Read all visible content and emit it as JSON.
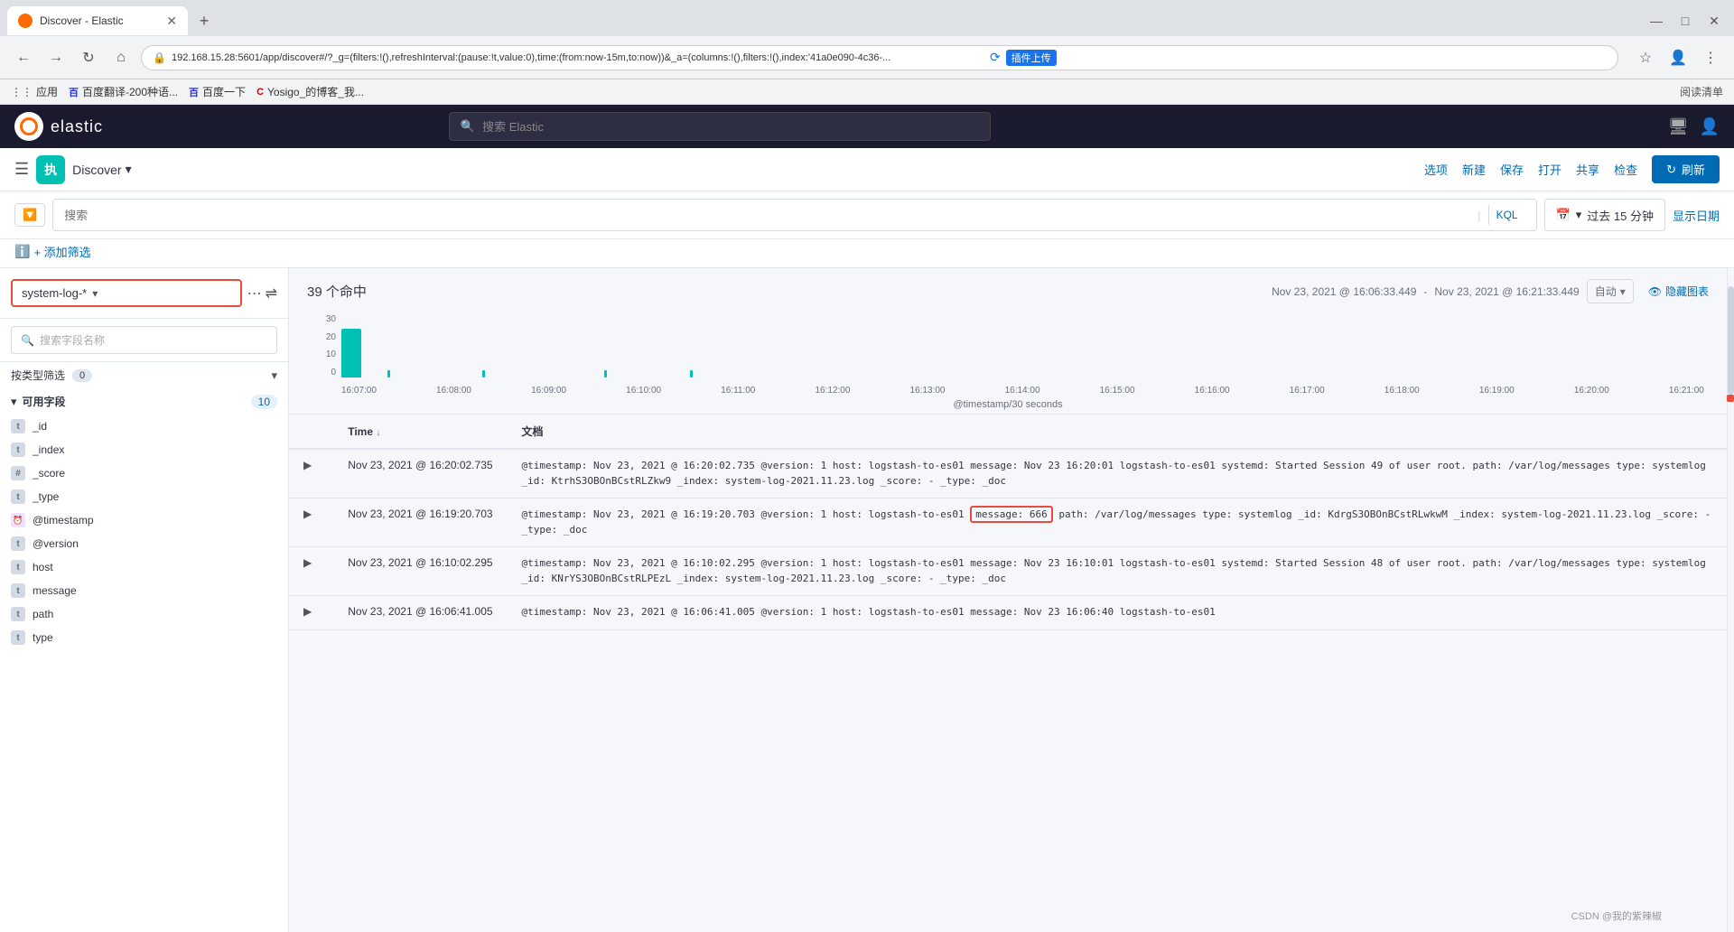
{
  "browser": {
    "tab_title": "Discover - Elastic",
    "address": "192.168.15.28:5601/app/discover#/?_g=(filters:!(),refreshInterval:(pause:!t,value:0),time:(from:now-15m,to:now))&_a=(columns:!(),filters:!(),index:'41a0e090-4c36-...",
    "bookmarks": [
      {
        "label": "应用",
        "icon": "grid"
      },
      {
        "label": "百度翻译-200种语...",
        "icon": "baidu"
      },
      {
        "label": "百度一下",
        "icon": "baidu2"
      },
      {
        "label": "Yosigo_的博客_我...",
        "icon": "csdn"
      }
    ]
  },
  "topnav": {
    "logo_text": "elastic",
    "search_placeholder": "搜索 Elastic",
    "right_icon1": "monitor",
    "right_icon2": "user"
  },
  "secondary_nav": {
    "app_icon": "执",
    "discover_label": "Discover",
    "actions": {
      "options": "选项",
      "new": "新建",
      "save": "保存",
      "open": "打开",
      "share": "共享",
      "inspect": "检查",
      "refresh": "刷新"
    }
  },
  "search_row": {
    "placeholder": "搜索",
    "kql_label": "KQL",
    "calendar_icon": "calendar",
    "time_range": "过去 15 分钟",
    "show_date_label": "显示日期"
  },
  "filter_row": {
    "add_filter_label": "+ 添加筛选"
  },
  "sidebar": {
    "index_pattern": "system-log-*",
    "search_placeholder": "搜索字段名称",
    "filter_type_label": "按类型筛选",
    "filter_count": "0",
    "available_fields_label": "可用字段",
    "available_fields_count": "10",
    "fields": [
      {
        "type": "t",
        "name": "_id"
      },
      {
        "type": "t",
        "name": "_index"
      },
      {
        "type": "hash",
        "name": "_score"
      },
      {
        "type": "t",
        "name": "_type"
      },
      {
        "type": "date",
        "name": "@timestamp"
      },
      {
        "type": "t",
        "name": "@version"
      },
      {
        "type": "t",
        "name": "host"
      },
      {
        "type": "t",
        "name": "message"
      },
      {
        "type": "t",
        "name": "path"
      },
      {
        "type": "t",
        "name": "type"
      }
    ]
  },
  "chart": {
    "results_count": "39 个命中",
    "date_start": "Nov 23, 2021 @ 16:06:33.449",
    "date_end": "Nov 23, 2021 @ 16:21:33.449",
    "auto_label": "自动",
    "hide_chart_label": "隐藏图表",
    "y_axis": [
      "30",
      "20",
      "10",
      "0"
    ],
    "x_axis": [
      "16:07:00",
      "16:08:00",
      "16:09:00",
      "16:10:00",
      "16:11:00",
      "16:12:00",
      "16:13:00",
      "16:14:00",
      "16:15:00",
      "16:16:00",
      "16:17:00",
      "16:18:00",
      "16:19:00",
      "16:20:00",
      "16:21:00"
    ],
    "timestamp_label": "@timestamp/30 seconds"
  },
  "table": {
    "col_time": "Time",
    "col_document": "文档",
    "rows": [
      {
        "time": "Nov 23, 2021 @ 16:20:02.735",
        "content": "@timestamp: Nov 23, 2021 @ 16:20:02.735  @version: 1  host: logstash-to-es01  message: Nov 23 16:20:01 logstash-to-es01 systemd: Started Session 49 of user root.  path: /var/log/messages  type: systemlog  _id: KtrhS3OBOnBCstRLZkw9  _index: system-log-2021.11.23.log  _score: -  _type: _doc"
      },
      {
        "time": "Nov 23, 2021 @ 16:19:20.703",
        "content": "@timestamp: Nov 23, 2021 @ 16:19:20.703  @version: 1  host: logstash-to-es01  [message: 666]  path: /var/log/messages  type: systemlog  _id: KdrgS3OBOnBCstRLwkwM  _index: system-log-2021.11.23.log  _score: -  _type: _doc",
        "highlight": "message: 666"
      },
      {
        "time": "Nov 23, 2021 @ 16:10:02.295",
        "content": "@timestamp: Nov 23, 2021 @ 16:10:02.295  @version: 1  host: logstash-to-es01  message: Nov 23 16:10:01 logstash-to-es01 systemd: Started Session 48 of user root.  path: /var/log/messages  type: systemlog  _id: KNrYS3OBOnBCstRLPEzL  _index: system-log-2021.11.23.log  _score: -  _type: _doc"
      },
      {
        "time": "Nov 23, 2021 @ 16:06:41.005",
        "content": "@timestamp: Nov 23, 2021 @ 16:06:41.005  @version: 1  host: logstash-to-es01  message: Nov 23 16:06:40 logstash-to-es01"
      }
    ]
  },
  "watermark": "CSDN @我的紫辣椒"
}
